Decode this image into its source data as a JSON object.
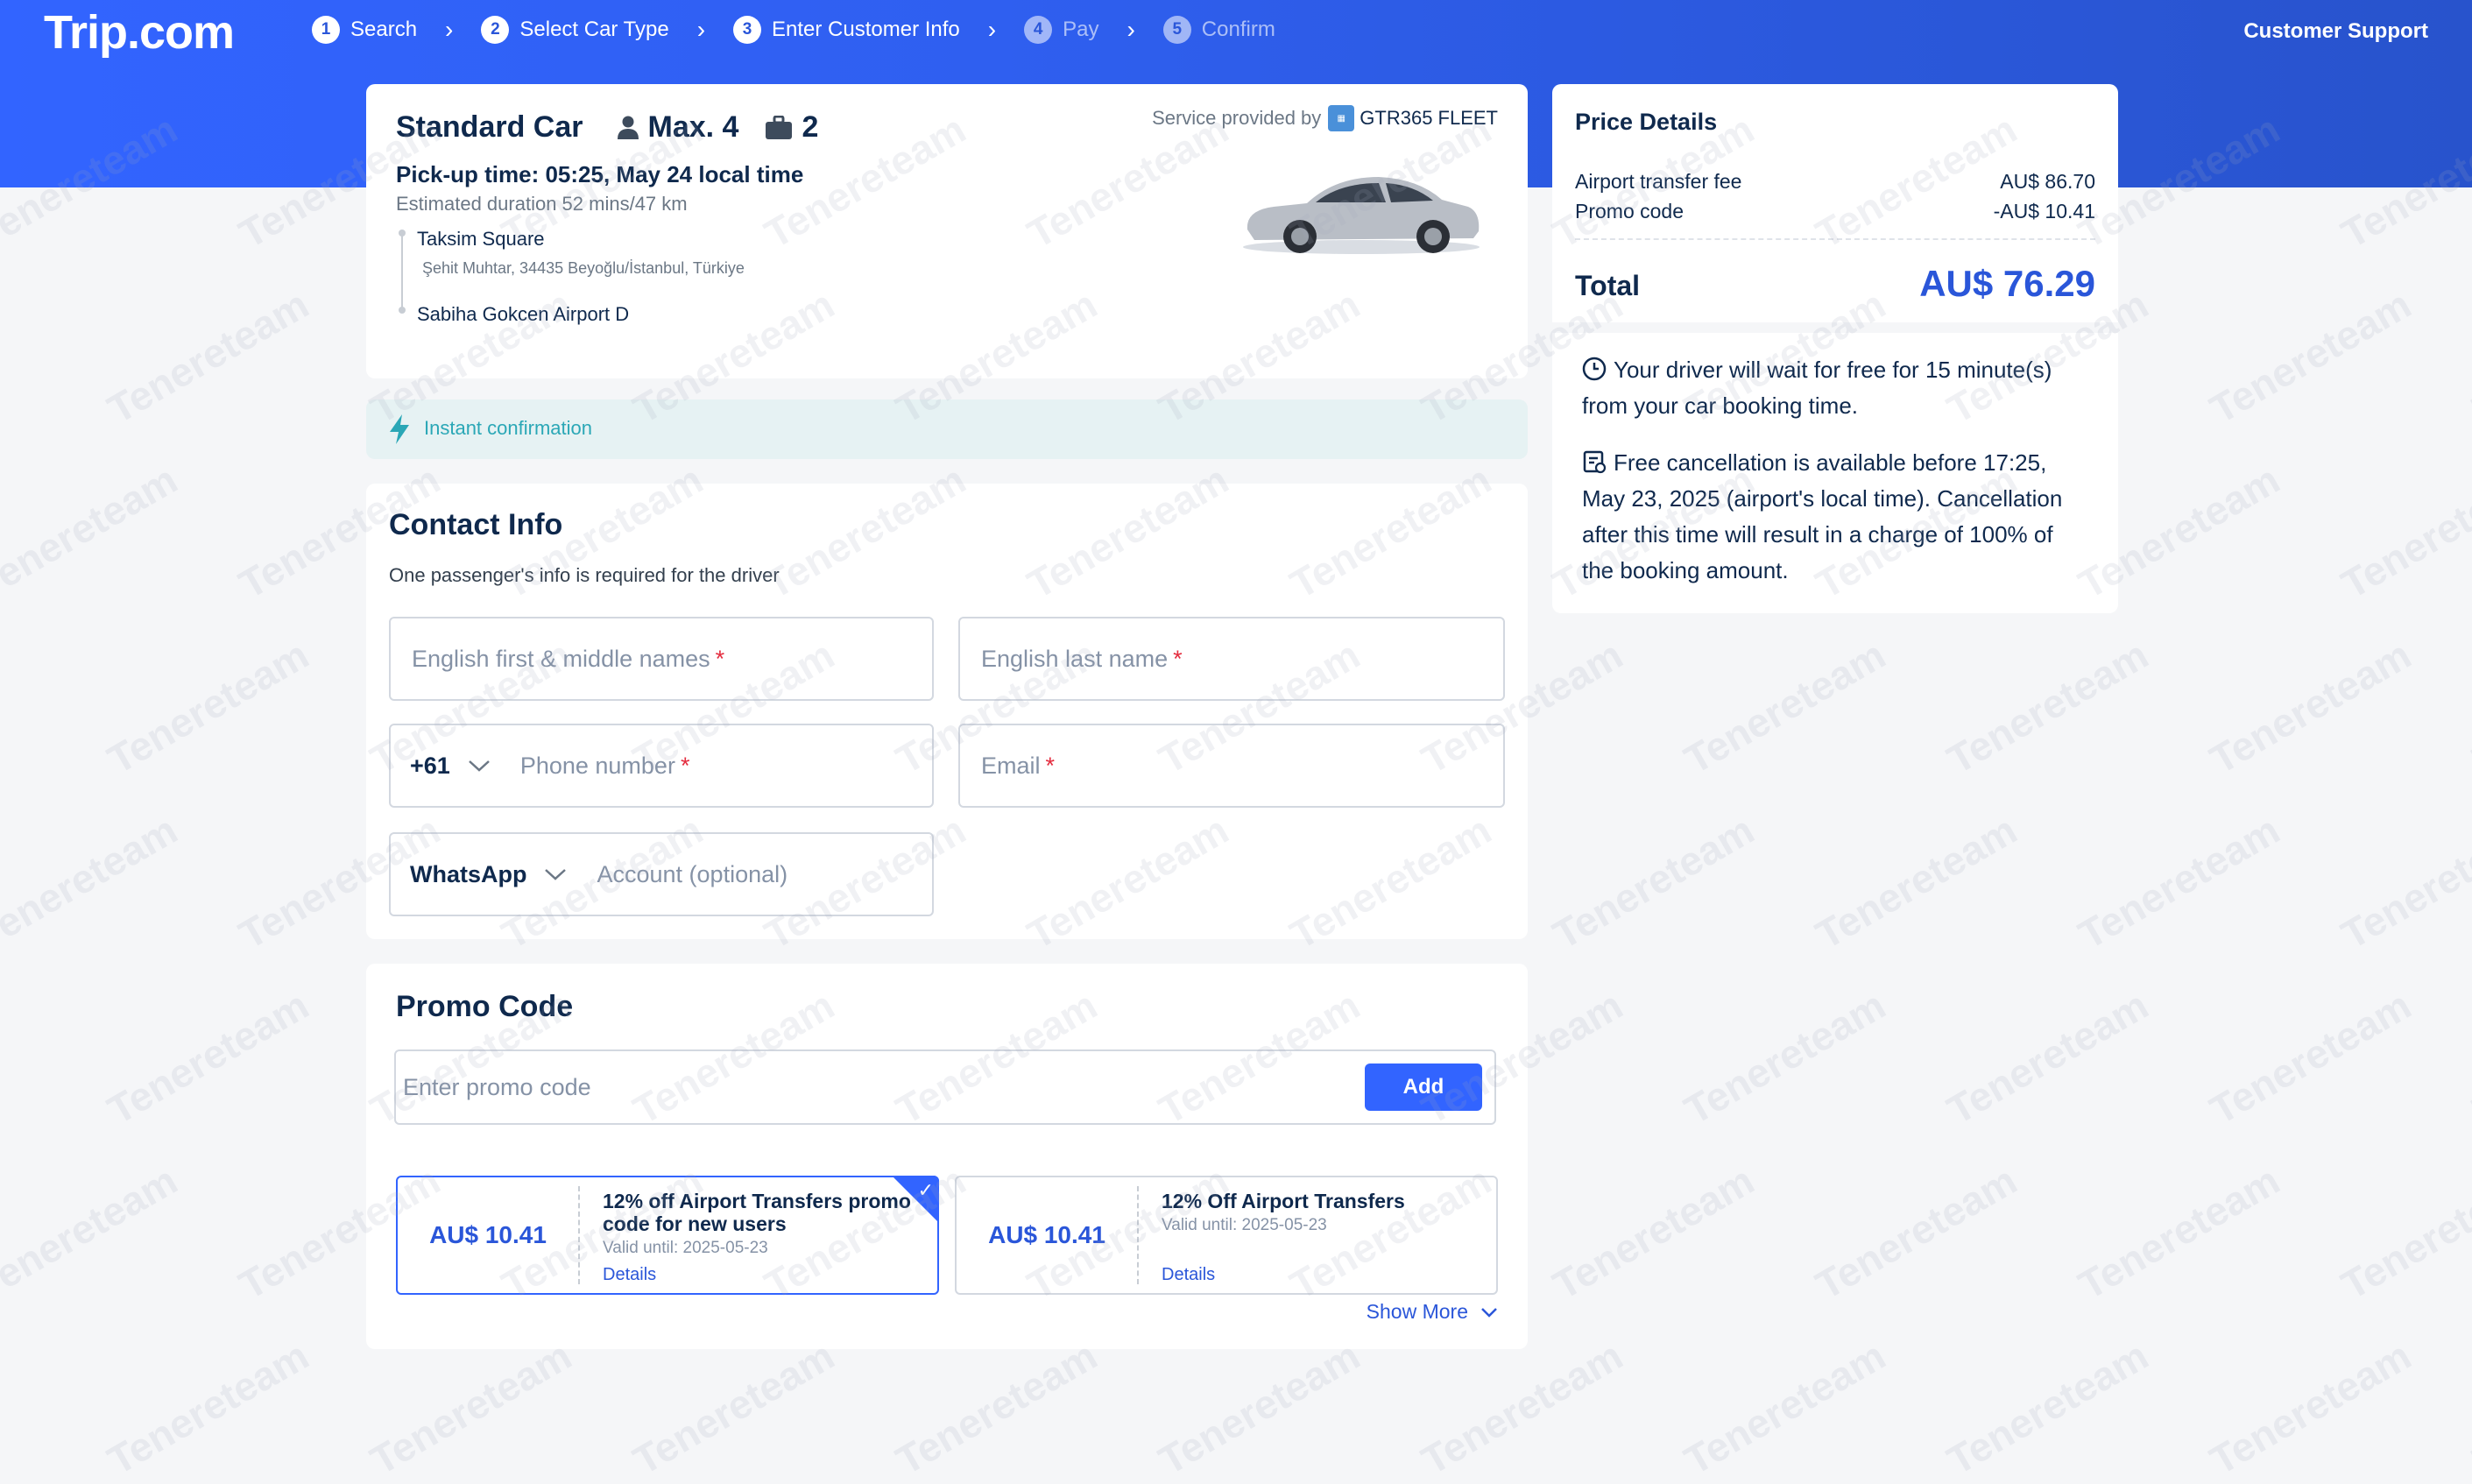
{
  "header": {
    "logo": "Trip.com",
    "steps": [
      {
        "num": "1",
        "label": "Search"
      },
      {
        "num": "2",
        "label": "Select Car Type"
      },
      {
        "num": "3",
        "label": "Enter Customer Info"
      },
      {
        "num": "4",
        "label": "Pay"
      },
      {
        "num": "5",
        "label": "Confirm"
      }
    ],
    "support": "Customer Support"
  },
  "car": {
    "type": "Standard Car",
    "passengers": "Max. 4",
    "luggage": "2",
    "provider_label": "Service provided by",
    "provider_name": "GTR365 FLEET",
    "pickup": "Pick-up time: 05:25, May 24 local time",
    "duration": "Estimated duration 52 mins/47 km",
    "from": "Taksim Square",
    "from_address": "Şehit Muhtar, 34435 Beyoğlu/İstanbul, Türkiye",
    "to": "Sabiha Gokcen Airport D"
  },
  "instant": "Instant confirmation",
  "contact": {
    "title": "Contact Info",
    "subtitle": "One passenger's info is required for the driver",
    "first_name_placeholder": "English first & middle names",
    "last_name_placeholder": "English last name",
    "phone_code": "+61",
    "phone_placeholder": "Phone number",
    "email_placeholder": "Email",
    "messenger": "WhatsApp",
    "account_placeholder": "Account (optional)",
    "required_mark": "*"
  },
  "promo": {
    "title": "Promo Code",
    "input_placeholder": "Enter promo code",
    "add_label": "Add",
    "coupons": [
      {
        "amount": "AU$ 10.41",
        "title": "12% off Airport Transfers promo code for new users",
        "valid": "Valid until: 2025-05-23",
        "details": "Details",
        "selected": true
      },
      {
        "amount": "AU$ 10.41",
        "title": "12% Off Airport Transfers",
        "valid": "Valid until: 2025-05-23",
        "details": "Details",
        "selected": false
      }
    ],
    "show_more": "Show More"
  },
  "price": {
    "title": "Price Details",
    "lines": [
      {
        "label": "Airport transfer fee",
        "value": "AU$ 86.70"
      },
      {
        "label": "Promo code",
        "value": "-AU$ 10.41"
      }
    ],
    "total_label": "Total",
    "total_value": "AU$ 76.29",
    "wait_note": "Your driver will wait for free for 15 minute(s) from your car booking time.",
    "cancel_note": "Free cancellation is available before 17:25, May 23, 2025 (airport's local time). Cancellation after this time will result in a charge of 100% of the booking amount."
  },
  "watermark": "Tenereteam",
  "colors": {
    "brand": "#3264ff",
    "price": "#2a56d9",
    "instant": "#2aa7b6",
    "required": "#e42d3f"
  }
}
